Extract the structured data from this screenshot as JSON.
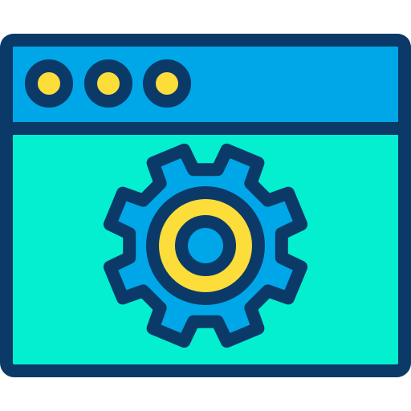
{
  "icon": {
    "name": "browser-window-settings-gear-icon",
    "colors": {
      "outline": "#0B3A68",
      "title_bar": "#00A7E8",
      "window_body": "#03EFD0",
      "gear": "#00A7E8",
      "dots": "#FCDD3A",
      "gear_ring": "#FCDD3A",
      "gear_center": "#00A7E8",
      "background": "#FFFFFF"
    },
    "title_bar_dot_count": 3,
    "gear_teeth": 8
  }
}
